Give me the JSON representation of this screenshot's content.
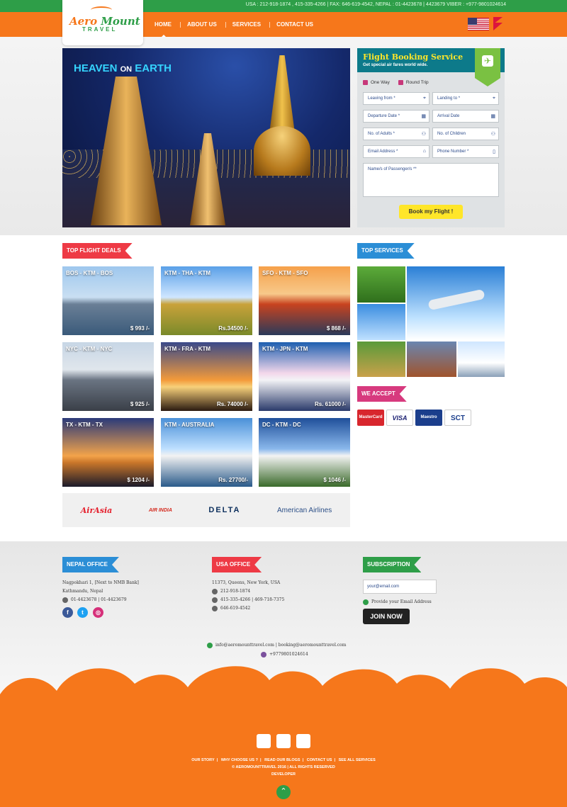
{
  "header": {
    "contact_line": "USA : 212-918-1874 , 415-335-4266 | FAX: 646-619-4542, NEPAL : 01-4423678 | 4423679 VIBER : +977-9801024614",
    "logo_text_1": "Aero",
    "logo_text_2": "Mount",
    "logo_sub": "TRAVEL",
    "nav": [
      "HOME",
      "ABOUT US",
      "SERVICES",
      "CONTACT US"
    ]
  },
  "hero": {
    "title_1": "HEAVEN",
    "title_mid": "ON",
    "title_2": "EARTH"
  },
  "booking": {
    "title": "Flight Booking Service",
    "subtitle": "Get special air fares world wide.",
    "one_way": "One Way",
    "round_trip": "Round Trip",
    "leaving_from": "Leaving from *",
    "landing_to": "Landing to *",
    "departure_date": "Departure Date *",
    "arrival_date": "Arrival Date",
    "num_adults": "No. of Adults *",
    "num_children": "No. of Children",
    "email": "Email Address *",
    "phone": "Phone Number *",
    "passengers": "Name/s of Passenger/s **",
    "submit": "Book my Flight !"
  },
  "deals": {
    "heading": "TOP FLIGHT DEALS",
    "items": [
      {
        "route": "BOS - KTM - BOS",
        "price": "$ 993 /-"
      },
      {
        "route": "KTM - THA - KTM",
        "price": "Rs.34500 /-"
      },
      {
        "route": "SFO - KTM - SFO",
        "price": "$ 868 /-"
      },
      {
        "route": "NYC - KTM - NYC",
        "price": "$ 925 /-"
      },
      {
        "route": "KTM - FRA - KTM",
        "price": "Rs. 74000 /-"
      },
      {
        "route": "KTM - JPN - KTM",
        "price": "Rs. 61000 /-"
      },
      {
        "route": "TX - KTM - TX",
        "price": "$ 1204 /-"
      },
      {
        "route": "KTM - AUSTRALIA",
        "price": "Rs. 27700/-"
      },
      {
        "route": "DC - KTM - DC",
        "price": "$ 1046 /-"
      }
    ]
  },
  "airlines": [
    "AirAsia",
    "AIR INDIA",
    "DELTA",
    "American Airlines"
  ],
  "services": {
    "heading": "TOP SERVICES"
  },
  "accept": {
    "heading": "WE ACCEPT",
    "cards": [
      "MasterCard",
      "VISA",
      "Maestro",
      "SCT"
    ]
  },
  "footer": {
    "nepal_heading": "NEPAL OFFICE",
    "nepal_addr1": "Nagpokhari 1, [Next to NMB Bank]",
    "nepal_addr2": "Kathmandu, Nepal",
    "nepal_phone": "01-4423678 | 01-4423679",
    "usa_heading": "USA OFFICE",
    "usa_addr": "11373, Queens, New York, USA",
    "usa_phone1": "212-918-1874",
    "usa_phone2": "415-335-4266 | 469-718-7375",
    "usa_fax": "646-619-4542",
    "sub_heading": "SUBSCRIPTION",
    "sub_placeholder": "your@email.com",
    "sub_hint": "Provide your Email Address",
    "join": "JOIN NOW",
    "emails": "info@aeromounttravel.com | booking@aeromounttravel.com",
    "viber": "+9779801024614",
    "links": [
      "OUR STORY",
      "WHY CHOOSE US ?",
      "READ OUR BLOGS",
      "CONTACT US",
      "SEE ALL SERVICES"
    ],
    "copyright": "© AEROMOUNTTRAVEL 2016   |   ALL RIGHTS RESERVED",
    "developer": "DEVELOPER"
  },
  "facebook_tab": "facebook",
  "colors": {
    "orange": "#f6771b",
    "green": "#2e9e48",
    "red": "#ee3a45",
    "blue": "#2b8ed6",
    "pink": "#d73a7e"
  }
}
